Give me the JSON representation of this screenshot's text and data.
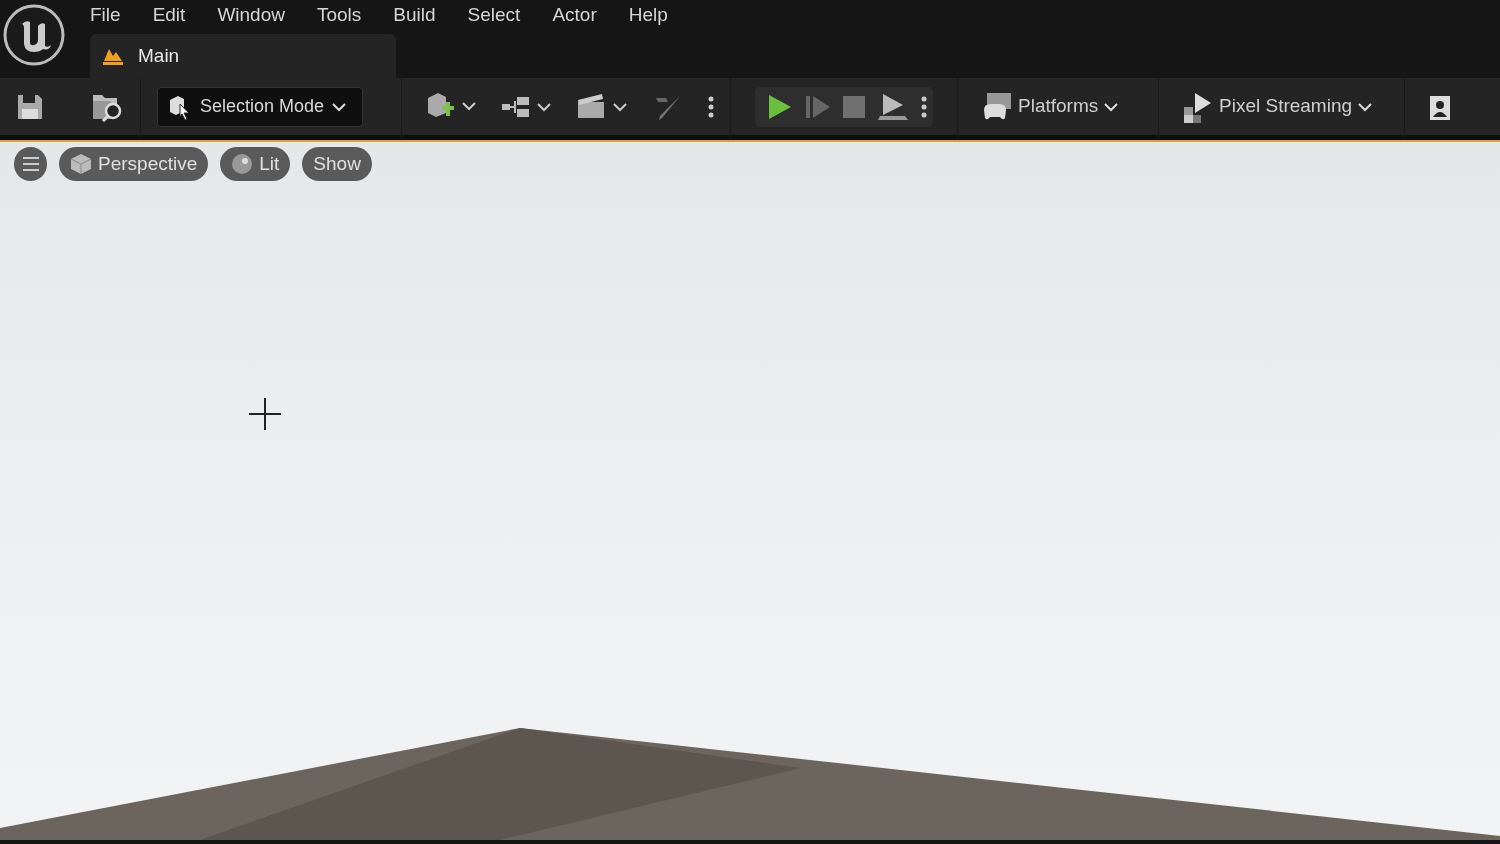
{
  "menu": [
    "File",
    "Edit",
    "Window",
    "Tools",
    "Build",
    "Select",
    "Actor",
    "Help"
  ],
  "tabs": [
    {
      "label": "Main",
      "selected": true
    }
  ],
  "toolbar": {
    "mode_button": "Selection Mode",
    "platforms_button": "Platforms",
    "pixel_streaming_button": "Pixel Streaming"
  },
  "viewport": {
    "buttons": [
      "Perspective",
      "Lit",
      "Show"
    ]
  }
}
